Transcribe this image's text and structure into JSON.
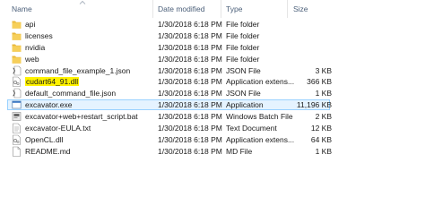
{
  "columns": {
    "name": "Name",
    "date_modified": "Date modified",
    "type": "Type",
    "size": "Size"
  },
  "files": [
    {
      "name": "api",
      "date": "1/30/2018 6:18 PM",
      "type": "File folder",
      "size": "",
      "icon": "folder-icon"
    },
    {
      "name": "licenses",
      "date": "1/30/2018 6:18 PM",
      "type": "File folder",
      "size": "",
      "icon": "folder-icon"
    },
    {
      "name": "nvidia",
      "date": "1/30/2018 6:18 PM",
      "type": "File folder",
      "size": "",
      "icon": "folder-icon"
    },
    {
      "name": "web",
      "date": "1/30/2018 6:18 PM",
      "type": "File folder",
      "size": "",
      "icon": "folder-icon"
    },
    {
      "name": "command_file_example_1.json",
      "date": "1/30/2018 6:18 PM",
      "type": "JSON File",
      "size": "3 KB",
      "icon": "json-file-icon"
    },
    {
      "name": "cudart64_91.dll",
      "date": "1/30/2018 6:18 PM",
      "type": "Application extens...",
      "size": "366 KB",
      "icon": "dll-file-icon",
      "highlighted": true
    },
    {
      "name": "default_command_file.json",
      "date": "1/30/2018 6:18 PM",
      "type": "JSON File",
      "size": "1 KB",
      "icon": "json-file-icon"
    },
    {
      "name": "excavator.exe",
      "date": "1/30/2018 6:18 PM",
      "type": "Application",
      "size": "11,196 KB",
      "icon": "exe-file-icon",
      "selected": true
    },
    {
      "name": "excavator+web+restart_script.bat",
      "date": "1/30/2018 6:18 PM",
      "type": "Windows Batch File",
      "size": "2 KB",
      "icon": "bat-file-icon"
    },
    {
      "name": "excavator-EULA.txt",
      "date": "1/30/2018 6:18 PM",
      "type": "Text Document",
      "size": "12 KB",
      "icon": "txt-file-icon"
    },
    {
      "name": "OpenCL.dll",
      "date": "1/30/2018 6:18 PM",
      "type": "Application extens...",
      "size": "64 KB",
      "icon": "dll-file-icon"
    },
    {
      "name": "README.md",
      "date": "1/30/2018 6:18 PM",
      "type": "MD File",
      "size": "1 KB",
      "icon": "md-file-icon"
    }
  ],
  "colors": {
    "highlight": "#fff200",
    "folder": "#f3c94a",
    "header_text": "#4c607a",
    "selection_border": "#99d1ff"
  }
}
